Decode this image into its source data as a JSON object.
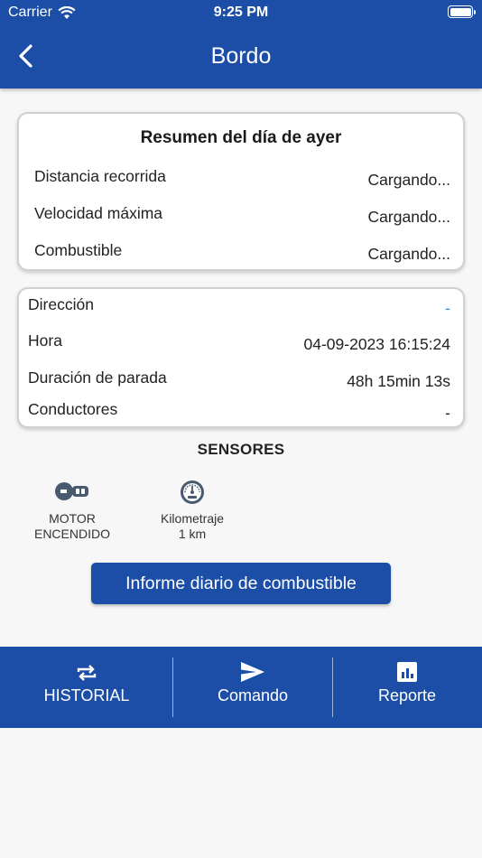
{
  "status_bar": {
    "carrier": "Carrier",
    "time": "9:25 PM"
  },
  "header": {
    "title": "Bordo",
    "back_icon": "chevron-left-icon"
  },
  "summary": {
    "title": "Resumen del día de ayer",
    "rows": [
      {
        "label": "Distancia recorrida",
        "value": "Cargando..."
      },
      {
        "label": "Velocidad máxima",
        "value": "Cargando..."
      },
      {
        "label": "Combustible",
        "value": "Cargando..."
      }
    ]
  },
  "details": {
    "rows": [
      {
        "label": "Dirección",
        "value": "-"
      },
      {
        "label": "Hora",
        "value": "04-09-2023 16:15:24"
      },
      {
        "label": "Duración de parada",
        "value": "48h 15min 13s"
      },
      {
        "label": "Conductores",
        "value": "-"
      }
    ]
  },
  "sensors": {
    "title": "SENSORES",
    "items": [
      {
        "line1": "MOTOR",
        "line2": "ENCENDIDO",
        "icon": "ignition-key-icon"
      },
      {
        "line1": "Kilometraje",
        "line2": "1 km",
        "icon": "speedometer-icon"
      }
    ]
  },
  "fuel_button": {
    "label": "Informe diario de combustible"
  },
  "bottom_nav": {
    "tabs": [
      {
        "label": "HISTORIAL",
        "icon": "repeat-arrows-icon"
      },
      {
        "label": "Comando",
        "icon": "send-icon"
      },
      {
        "label": "Reporte",
        "icon": "bar-chart-icon"
      }
    ]
  },
  "colors": {
    "primary": "#1c4ea8",
    "link": "#3b82f6",
    "background": "#f7f7f7"
  }
}
